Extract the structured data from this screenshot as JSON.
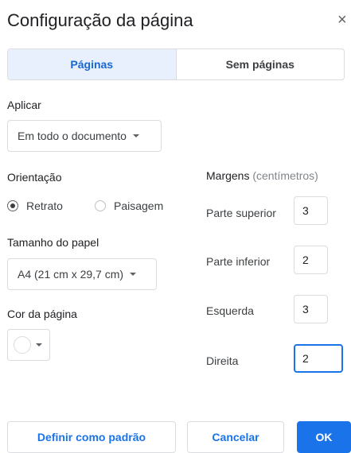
{
  "dialog": {
    "title": "Configuração da página",
    "close_glyph": "×"
  },
  "tabs": [
    {
      "label": "Páginas",
      "active": true
    },
    {
      "label": "Sem páginas",
      "active": false
    }
  ],
  "apply": {
    "label": "Aplicar",
    "value": "Em todo o documento"
  },
  "orientation": {
    "label": "Orientação",
    "options": [
      {
        "label": "Retrato",
        "selected": true
      },
      {
        "label": "Paisagem",
        "selected": false
      }
    ]
  },
  "paper_size": {
    "label": "Tamanho do papel",
    "value": "A4 (21 cm x 29,7 cm)"
  },
  "page_color": {
    "label": "Cor da página",
    "value": "#ffffff"
  },
  "margins": {
    "label": "Margens",
    "unit": "(centímetros)",
    "fields": [
      {
        "label": "Parte superior",
        "value": "3"
      },
      {
        "label": "Parte inferior",
        "value": "2"
      },
      {
        "label": "Esquerda",
        "value": "3"
      },
      {
        "label": "Direita",
        "value": "2"
      }
    ]
  },
  "buttons": {
    "set_default": "Definir como padrão",
    "cancel": "Cancelar",
    "ok": "OK"
  },
  "colors": {
    "accent": "#1a73e8",
    "tab_active_bg": "#e8f0fe"
  }
}
